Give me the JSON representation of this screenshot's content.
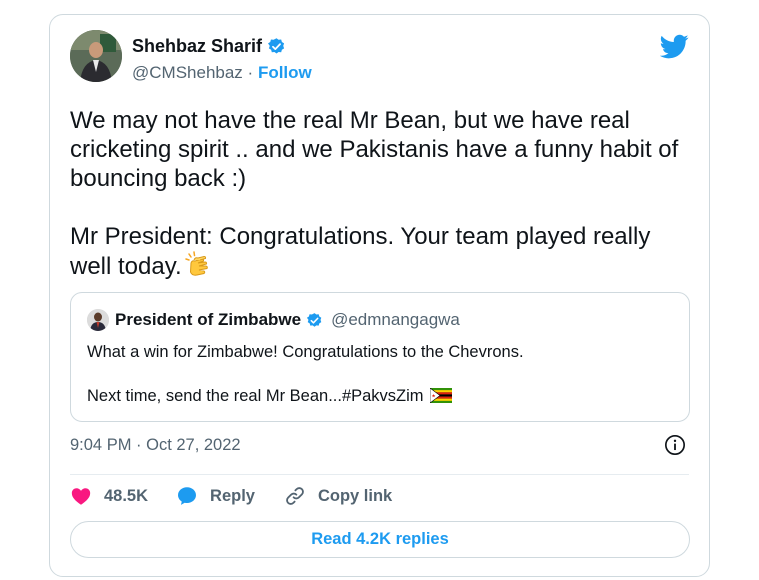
{
  "tweet": {
    "author": {
      "name": "Shehbaz Sharif",
      "handle": "@CMShehbaz",
      "follow_label": "Follow",
      "verified": true
    },
    "paragraphs": [
      "We may not have the real Mr Bean, but we have real cricketing spirit .. and we Pakistanis have a funny habit of bouncing back :)",
      "Mr President: Congratulations. Your team played really well today."
    ],
    "emoji_icon": "clapping-hands-icon",
    "timestamp": "9:04 PM · Oct 27, 2022",
    "likes": "48.5K",
    "reply_label": "Reply",
    "copy_link_label": "Copy link",
    "read_replies_label": "Read 4.2K replies"
  },
  "quoted": {
    "name": "President of Zimbabwe",
    "handle": "@edmnangagwa",
    "verified": true,
    "paragraphs": [
      "What a win for Zimbabwe! Congratulations to the Chevrons.",
      "Next time, send the real Mr Bean...#PakvsZim"
    ],
    "flag_icon": "zimbabwe-flag-icon"
  },
  "colors": {
    "accent": "#1d9bf0",
    "like": "#f91880",
    "text": "#0f1419",
    "secondary": "#536471",
    "border": "#cfd9de"
  }
}
